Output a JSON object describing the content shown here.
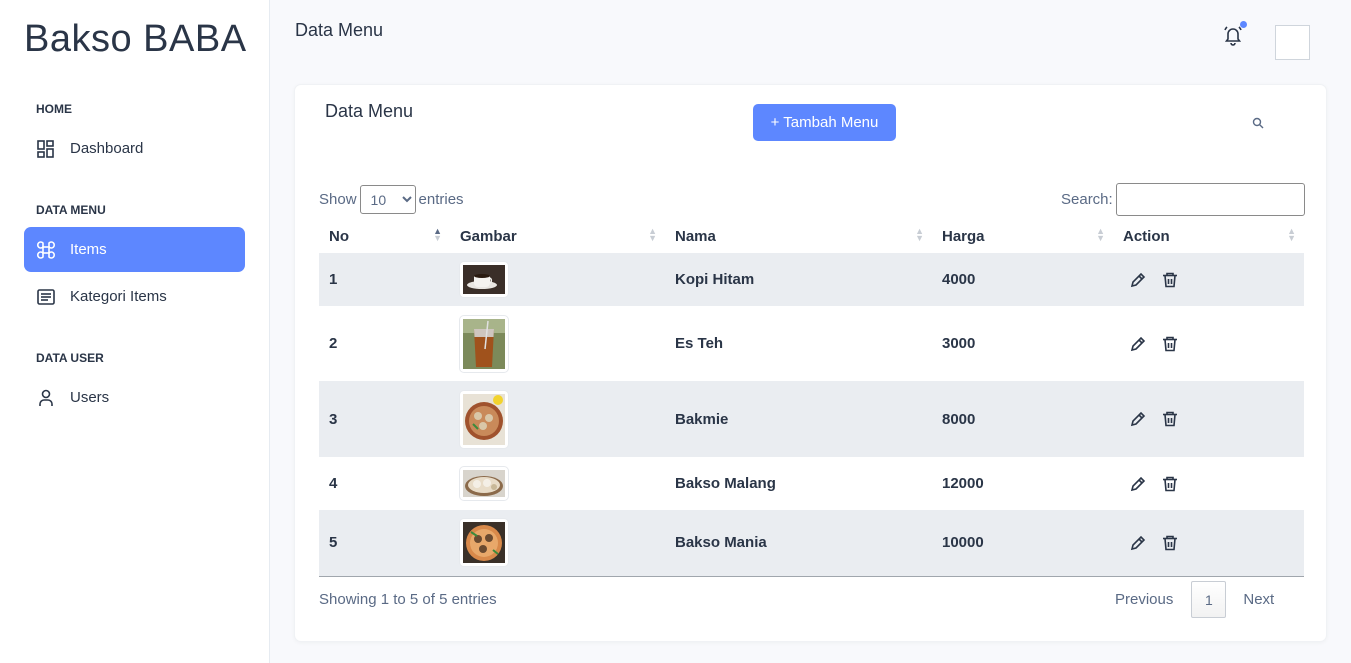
{
  "brand": "Bakso BABA",
  "sidebar": {
    "sections": [
      {
        "label": "HOME"
      },
      {
        "label": "DATA MENU"
      },
      {
        "label": "DATA USER"
      }
    ],
    "items": [
      {
        "label": "Dashboard",
        "icon": "dashboard-icon",
        "active": false
      },
      {
        "label": "Items",
        "icon": "apps-icon",
        "active": true
      },
      {
        "label": "Kategori Items",
        "icon": "list-icon",
        "active": false
      },
      {
        "label": "Users",
        "icon": "user-icon",
        "active": false
      }
    ]
  },
  "header": {
    "title": "Data Menu",
    "notification_icon": "bell-icon",
    "accent_color": "#5d87ff"
  },
  "card": {
    "title": "Data Menu",
    "add_button": "+ Tambah Menu",
    "search_icon": "search-icon"
  },
  "table_controls": {
    "show_label": "Show",
    "entries_label": "entries",
    "page_size": "10",
    "search_label": "Search:"
  },
  "table": {
    "columns": [
      "No",
      "Gambar",
      "Nama",
      "Harga",
      "Action"
    ],
    "rows": [
      {
        "no": "1",
        "image": "kopi-hitam-photo",
        "nama": "Kopi Hitam",
        "harga": "4000"
      },
      {
        "no": "2",
        "image": "es-teh-photo",
        "nama": "Es Teh",
        "harga": "3000"
      },
      {
        "no": "3",
        "image": "bakmie-photo",
        "nama": "Bakmie",
        "harga": "8000"
      },
      {
        "no": "4",
        "image": "bakso-malang-photo",
        "nama": "Bakso Malang",
        "harga": "12000"
      },
      {
        "no": "5",
        "image": "bakso-mania-photo",
        "nama": "Bakso Mania",
        "harga": "10000"
      }
    ]
  },
  "footer": {
    "info": "Showing 1 to 5 of 5 entries",
    "previous": "Previous",
    "page": "1",
    "next": "Next"
  }
}
